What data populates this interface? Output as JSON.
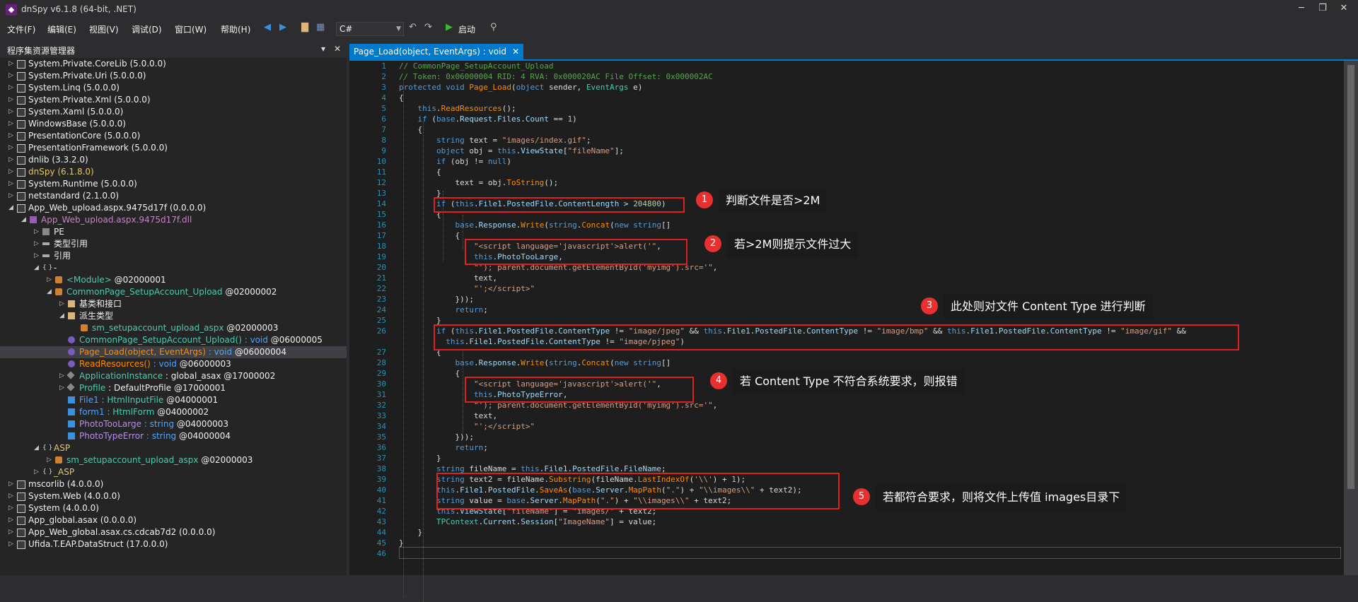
{
  "app": {
    "title": "dnSpy v6.1.8 (64-bit, .NET)"
  },
  "menu": [
    "文件(F)",
    "编辑(E)",
    "视图(V)",
    "调试(D)",
    "窗口(W)",
    "帮助(H)"
  ],
  "toolbar": {
    "language": "C#",
    "start_label": "启动"
  },
  "explorer": {
    "title": "程序集资源管理器",
    "items": [
      {
        "label": "System.Private.CoreLib (5.0.0.0)"
      },
      {
        "label": "System.Private.Uri (5.0.0.0)"
      },
      {
        "label": "System.Linq (5.0.0.0)"
      },
      {
        "label": "System.Private.Xml (5.0.0.0)"
      },
      {
        "label": "System.Xaml (5.0.0.0)"
      },
      {
        "label": "WindowsBase (5.0.0.0)"
      },
      {
        "label": "PresentationCore (5.0.0.0)"
      },
      {
        "label": "PresentationFramework (5.0.0.0)"
      },
      {
        "label": "dnlib (3.3.2.0)"
      },
      {
        "label": "dnSpy (6.1.8.0)"
      },
      {
        "label": "System.Runtime (5.0.0.0)"
      },
      {
        "label": "netstandard (2.1.0.0)"
      },
      {
        "label": "App_Web_upload.aspx.9475d17f (0.0.0.0)"
      },
      {
        "label": "App_Web_upload.aspx.9475d17f.dll"
      },
      {
        "label": "PE"
      },
      {
        "label": "类型引用"
      },
      {
        "label": "引用"
      },
      {
        "label": "-"
      },
      {
        "label": "<Module>",
        "token": "@02000001"
      },
      {
        "label": "CommonPage_SetupAccount_Upload",
        "token": "@02000002"
      },
      {
        "label": "基类和接口"
      },
      {
        "label": "派生类型"
      },
      {
        "label": "sm_setupaccount_upload_aspx",
        "token": "@02000003"
      },
      {
        "label": "CommonPage_SetupAccount_Upload()",
        "sig": " : void ",
        "token": "@06000005"
      },
      {
        "label": "Page_Load(object, EventArgs)",
        "sig": " : void ",
        "token": "@06000004"
      },
      {
        "label": "ReadResources()",
        "sig": " : void ",
        "token": "@06000003"
      },
      {
        "label": "ApplicationInstance",
        "sig": " : global_asax ",
        "token": "@17000002"
      },
      {
        "label": "Profile",
        "sig": " : DefaultProfile ",
        "token": "@17000001"
      },
      {
        "label": "File1",
        "sig": " : HtmlInputFile ",
        "token": "@04000001"
      },
      {
        "label": "form1",
        "sig": " : HtmlForm ",
        "token": "@04000002"
      },
      {
        "label": "PhotoTooLarge",
        "sig": " : string ",
        "token": "@04000003"
      },
      {
        "label": "PhotoTypeError",
        "sig": " : string ",
        "token": "@04000004"
      },
      {
        "label": "ASP"
      },
      {
        "label": "sm_setupaccount_upload_aspx",
        "token": "@02000003"
      },
      {
        "label": "_ASP"
      },
      {
        "label": "mscorlib (4.0.0.0)"
      },
      {
        "label": "System.Web (4.0.0.0)"
      },
      {
        "label": "System (4.0.0.0)"
      },
      {
        "label": "App_global.asax (0.0.0.0)"
      },
      {
        "label": "App_Web_global.asax.cs.cdcab7d2 (0.0.0.0)"
      },
      {
        "label": "Ufida.T.EAP.DataStruct (17.0.0.0)"
      }
    ]
  },
  "editor": {
    "tab_label": "Page_Load(object, EventArgs) : void",
    "line_numbers": [
      "1",
      "2",
      "3",
      "4",
      "5",
      "6",
      "7",
      "8",
      "9",
      "10",
      "11",
      "12",
      "13",
      "14",
      "15",
      "16",
      "17",
      "18",
      "19",
      "20",
      "21",
      "22",
      "23",
      "24",
      "25",
      "26",
      "27",
      "28",
      "29",
      "30",
      "31",
      "32",
      "33",
      "34",
      "35",
      "36",
      "37",
      "38",
      "39",
      "40",
      "41",
      "42",
      "43",
      "44",
      "45",
      "46"
    ],
    "annotations": [
      {
        "n": "1",
        "text": "判断文件是否>2M"
      },
      {
        "n": "2",
        "text": "若>2M则提示文件过大"
      },
      {
        "n": "3",
        "text": "此处则对文件 Content Type 进行判断"
      },
      {
        "n": "4",
        "text": "若 Content Type 不符合系统要求，则报错"
      },
      {
        "n": "5",
        "text": "若都符合要求，则将文件上传值 images目录下"
      }
    ]
  },
  "colors": {
    "accent": "#007acc",
    "highlight": "#e02020",
    "badge": "#e83030"
  }
}
